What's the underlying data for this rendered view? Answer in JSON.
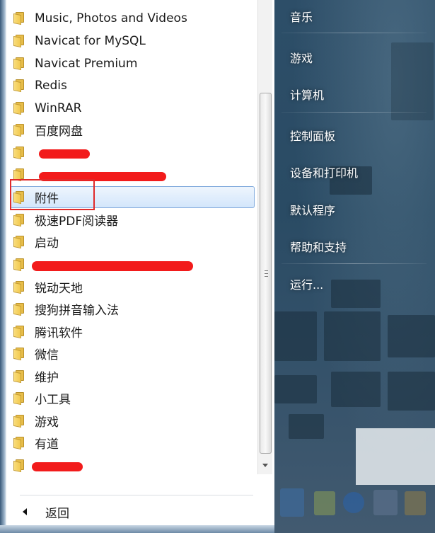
{
  "programs": {
    "items": [
      {
        "label": "Music, Photos and Videos",
        "selected": false
      },
      {
        "label": "Navicat for MySQL",
        "selected": false
      },
      {
        "label": "Navicat Premium",
        "selected": false
      },
      {
        "label": "Redis",
        "selected": false
      },
      {
        "label": "WinRAR",
        "selected": false
      },
      {
        "label": "百度网盘",
        "selected": false
      },
      {
        "label": "",
        "selected": false
      },
      {
        "label": "",
        "selected": false
      },
      {
        "label": "附件",
        "selected": true
      },
      {
        "label": "极速PDF阅读器",
        "selected": false
      },
      {
        "label": "启动",
        "selected": false
      },
      {
        "label": "",
        "selected": false
      },
      {
        "label": "锐动天地",
        "selected": false
      },
      {
        "label": "搜狗拼音输入法",
        "selected": false
      },
      {
        "label": "腾讯软件",
        "selected": false
      },
      {
        "label": "微信",
        "selected": false
      },
      {
        "label": "维护",
        "selected": false
      },
      {
        "label": "小工具",
        "selected": false
      },
      {
        "label": "游戏",
        "selected": false
      },
      {
        "label": "有道",
        "selected": false
      },
      {
        "label": "",
        "selected": false
      }
    ]
  },
  "back_label": "返回",
  "right_menu": {
    "items": [
      {
        "label": "音乐"
      },
      {
        "label": "游戏"
      },
      {
        "label": "计算机"
      },
      {
        "label": "控制面板"
      },
      {
        "label": "设备和打印机"
      },
      {
        "label": "默认程序"
      },
      {
        "label": "帮助和支持"
      },
      {
        "label": "运行..."
      }
    ]
  },
  "colors": {
    "selection_border": "#84acdd",
    "annotation_red": "#e02a2a",
    "redaction_red": "#f21b1b"
  },
  "icons": {
    "folder": "folder-icon",
    "back": "back-arrow-icon",
    "scroll_down": "scroll-down-icon"
  }
}
